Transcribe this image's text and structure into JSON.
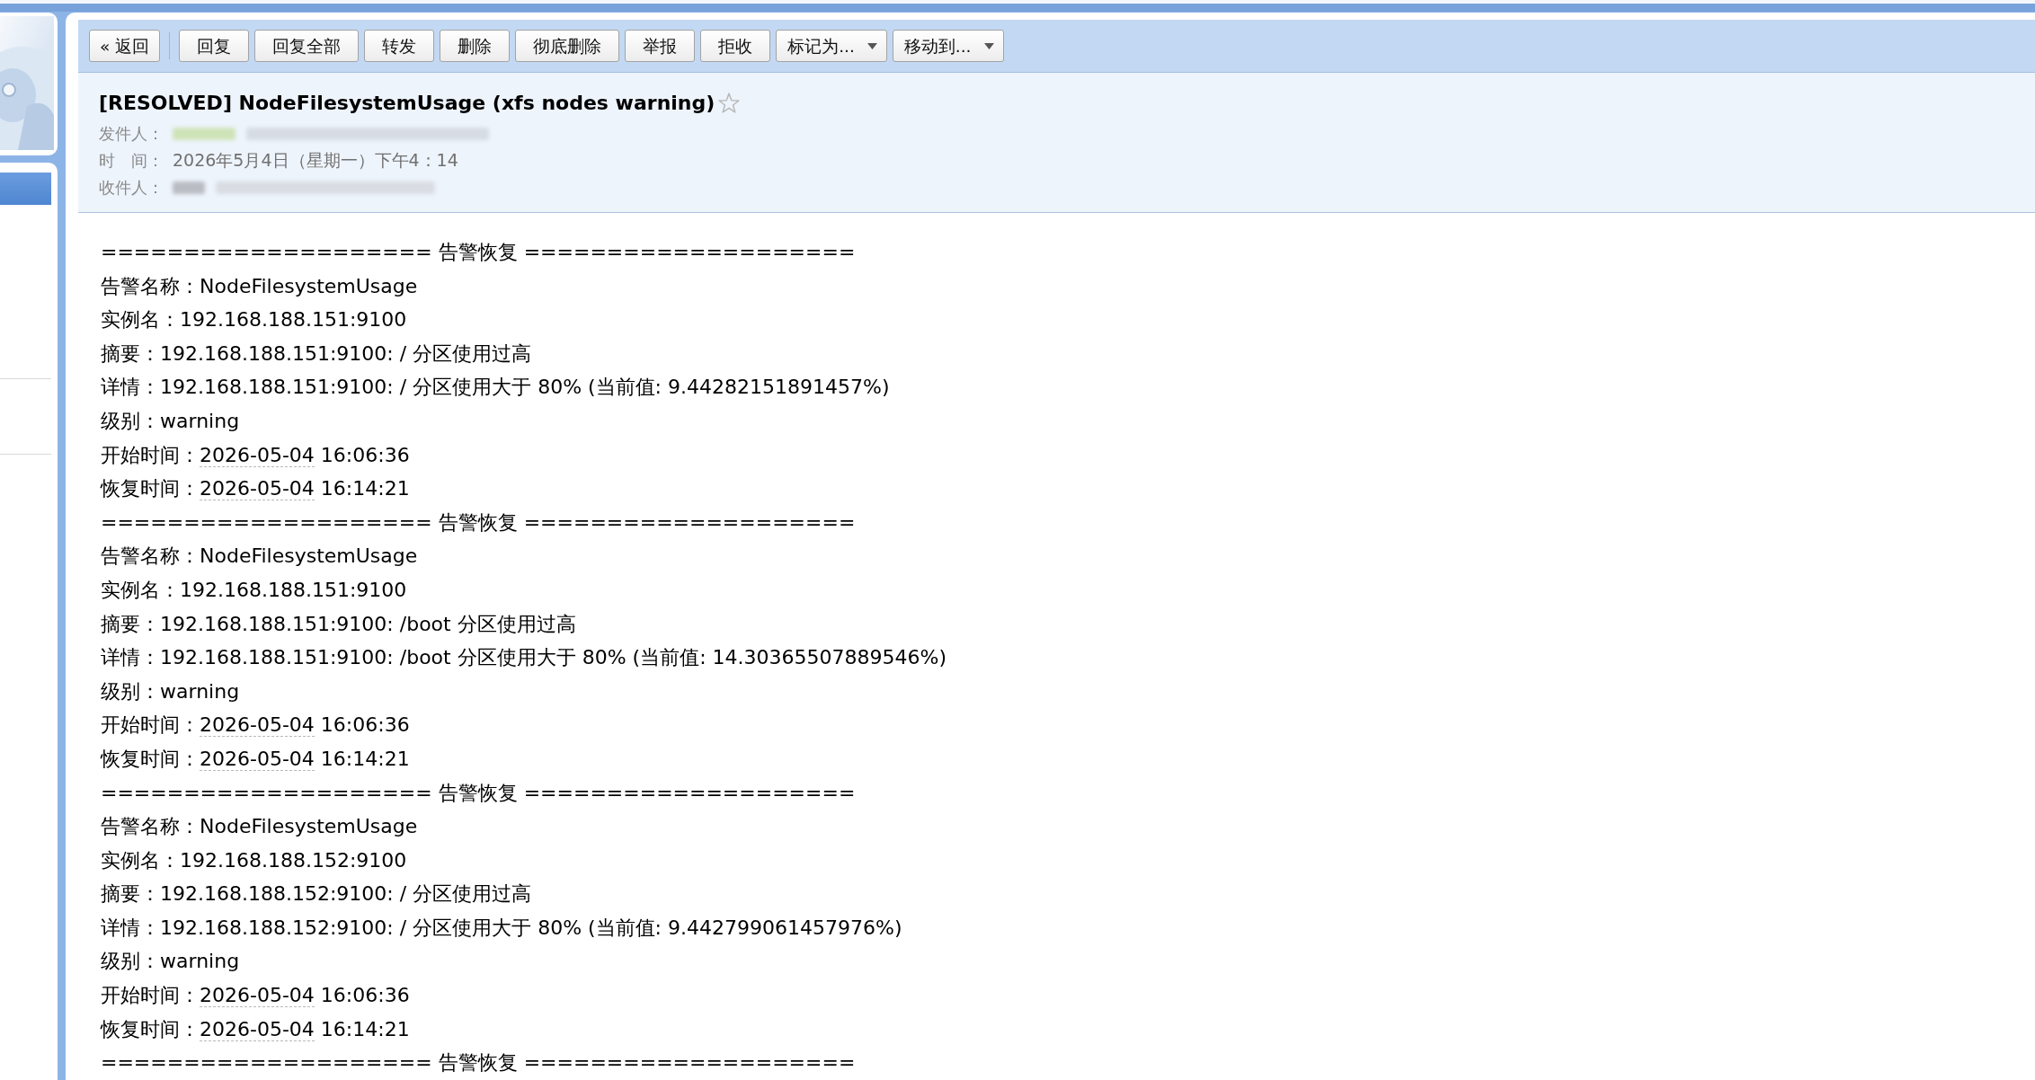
{
  "toolbar": {
    "back_button": "« 返回",
    "buttons": [
      {
        "label": "回复",
        "kind": "button"
      },
      {
        "label": "回复全部",
        "kind": "button"
      },
      {
        "label": "转发",
        "kind": "button"
      },
      {
        "label": "删除",
        "kind": "button"
      },
      {
        "label": "彻底删除",
        "kind": "button"
      },
      {
        "label": "举报",
        "kind": "button"
      },
      {
        "label": "拒收",
        "kind": "button"
      },
      {
        "label": "标记为...",
        "kind": "menu"
      },
      {
        "label": "移动到...",
        "kind": "menu"
      }
    ]
  },
  "message": {
    "subject": "[RESOLVED] NodeFilesystemUsage (xfs nodes warning)",
    "starred": false,
    "fields": [
      {
        "label": "发件人：",
        "kind": "redacted"
      },
      {
        "label": "时　间：",
        "kind": "text",
        "value": "2026年5月4日（星期一）下午4：14"
      },
      {
        "label": "收件人：",
        "kind": "redacted"
      }
    ]
  },
  "body": {
    "blocks": [
      {
        "heading": "==================== 告警恢复 ====================",
        "lines": [
          {
            "kind": "text",
            "text": "告警名称：NodeFilesystemUsage"
          },
          {
            "kind": "text",
            "text": "实例名：192.168.188.151:9100"
          },
          {
            "kind": "text",
            "text": "摘要：192.168.188.151:9100: / 分区使用过高"
          },
          {
            "kind": "text",
            "text": "详情：192.168.188.151:9100: / 分区使用大于 80% (当前值: 9.44282151891457%)"
          },
          {
            "kind": "text",
            "text": "级别：warning"
          },
          {
            "kind": "datetime",
            "label": "开始时间：",
            "date": "2026-05-04",
            "time": "16:06:36"
          },
          {
            "kind": "datetime",
            "label": "恢复时间：",
            "date": "2026-05-04",
            "time": "16:14:21"
          }
        ]
      },
      {
        "heading": "==================== 告警恢复 ====================",
        "lines": [
          {
            "kind": "text",
            "text": "告警名称：NodeFilesystemUsage"
          },
          {
            "kind": "text",
            "text": "实例名：192.168.188.151:9100"
          },
          {
            "kind": "text",
            "text": "摘要：192.168.188.151:9100: /boot 分区使用过高"
          },
          {
            "kind": "text",
            "text": "详情：192.168.188.151:9100: /boot 分区使用大于 80% (当前值: 14.30365507889546%)"
          },
          {
            "kind": "text",
            "text": "级别：warning"
          },
          {
            "kind": "datetime",
            "label": "开始时间：",
            "date": "2026-05-04",
            "time": "16:06:36"
          },
          {
            "kind": "datetime",
            "label": "恢复时间：",
            "date": "2026-05-04",
            "time": "16:14:21"
          }
        ]
      },
      {
        "heading": "==================== 告警恢复 ====================",
        "lines": [
          {
            "kind": "text",
            "text": "告警名称：NodeFilesystemUsage"
          },
          {
            "kind": "text",
            "text": "实例名：192.168.188.152:9100"
          },
          {
            "kind": "text",
            "text": "摘要：192.168.188.152:9100: / 分区使用过高"
          },
          {
            "kind": "text",
            "text": "详情：192.168.188.152:9100: / 分区使用大于 80% (当前值: 9.442799061457976%)"
          },
          {
            "kind": "text",
            "text": "级别：warning"
          },
          {
            "kind": "datetime",
            "label": "开始时间：",
            "date": "2026-05-04",
            "time": "16:06:36"
          },
          {
            "kind": "datetime",
            "label": "恢复时间：",
            "date": "2026-05-04",
            "time": "16:14:21"
          }
        ]
      },
      {
        "heading": "==================== 告警恢复 ===================="
      }
    ]
  }
}
